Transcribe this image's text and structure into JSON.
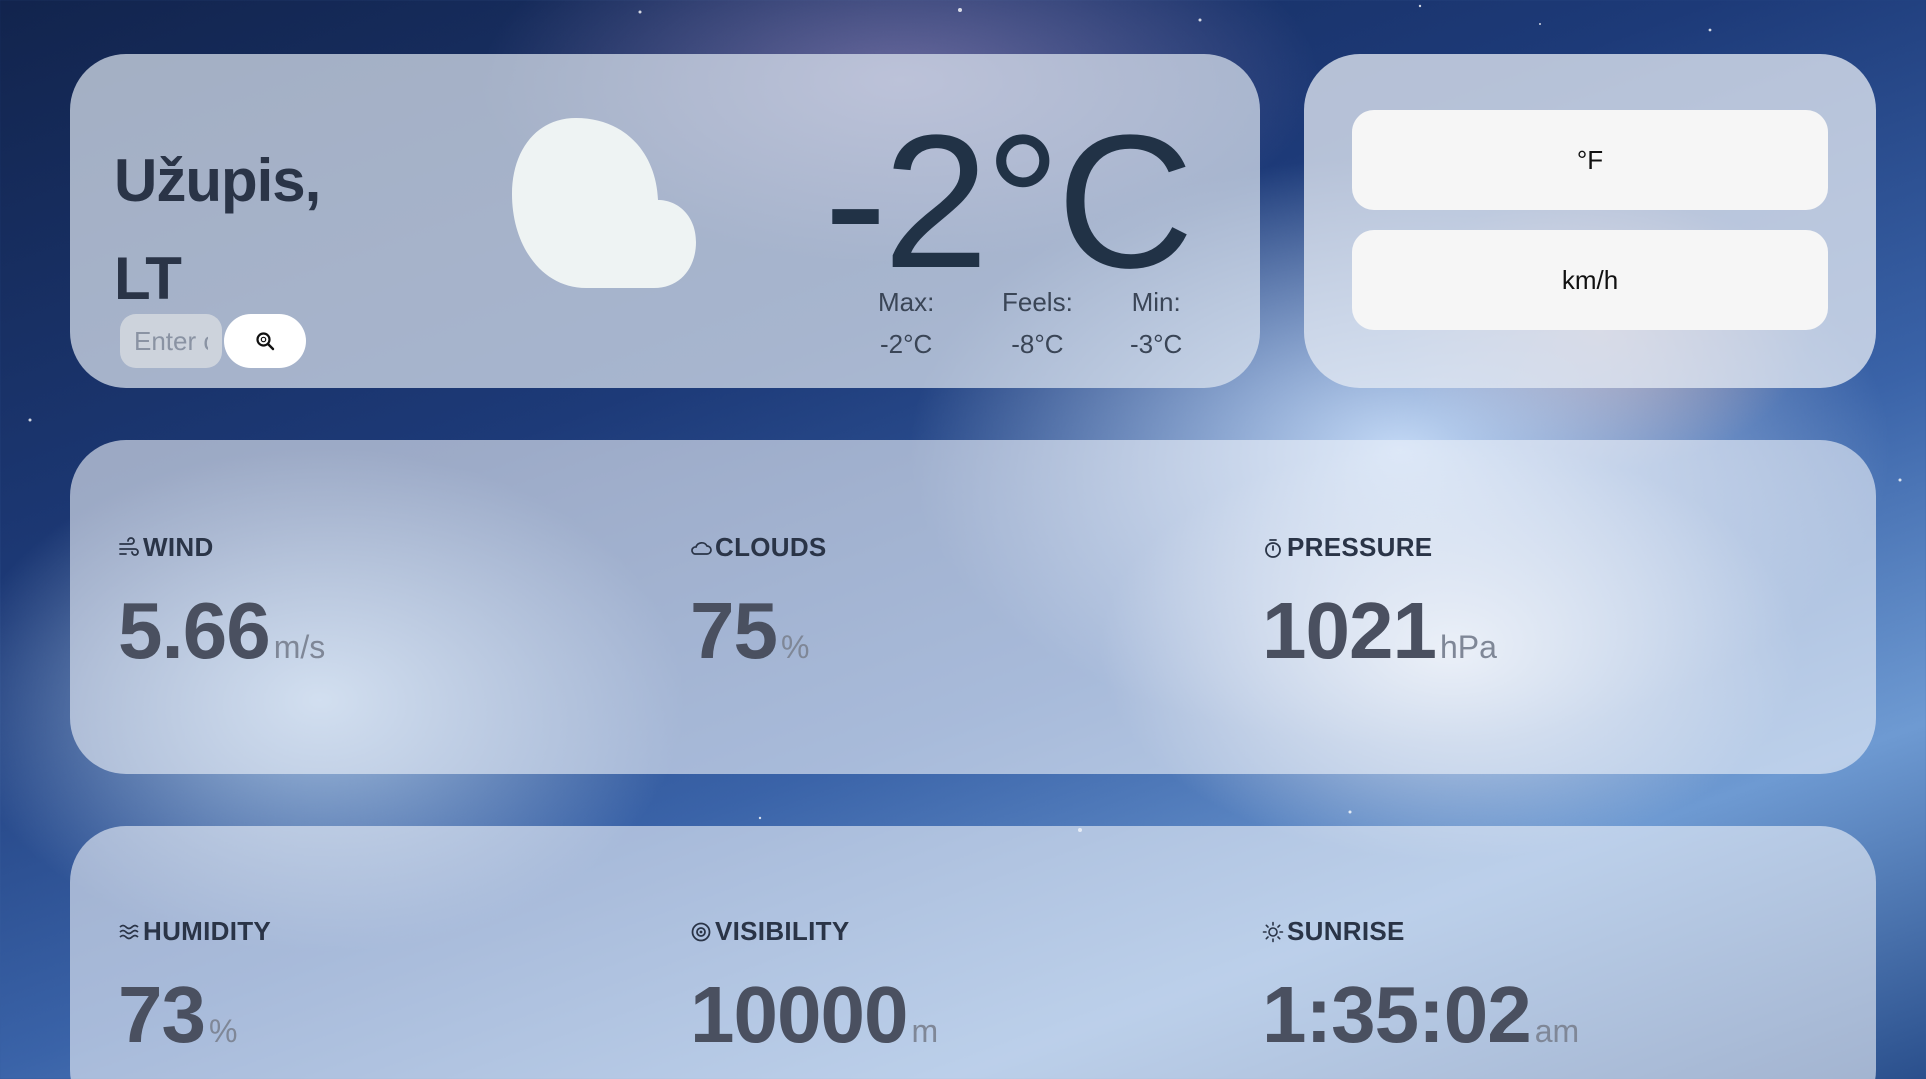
{
  "location": {
    "city": "Užupis,",
    "country": "LT"
  },
  "search": {
    "placeholder": "Enter c"
  },
  "current": {
    "condition_icon": "cloud-icon",
    "temperature": "-2°C",
    "max_label": "Max:",
    "max_value": "-2°C",
    "feels_label": "Feels:",
    "feels_value": "-8°C",
    "min_label": "Min:",
    "min_value": "-3°C"
  },
  "units": {
    "temp_toggle": "°F",
    "speed_toggle": "km/h"
  },
  "stats": {
    "wind": {
      "label": "WIND",
      "icon": "wind-icon",
      "value": "5.66",
      "unit": "m/s"
    },
    "clouds": {
      "label": "CLOUDS",
      "icon": "cloud-icon",
      "value": "75",
      "unit": "%"
    },
    "pressure": {
      "label": "PRESSURE",
      "icon": "gauge-icon",
      "value": "1021",
      "unit": "hPa"
    },
    "humidity": {
      "label": "HUMIDITY",
      "icon": "waves-icon",
      "value": "73",
      "unit": "%"
    },
    "visibility": {
      "label": "VISIBILITY",
      "icon": "eye-icon",
      "value": "10000",
      "unit": "m"
    },
    "sunrise": {
      "label": "SUNRISE",
      "icon": "sun-icon",
      "value": "1:35:02",
      "unit": "am"
    }
  },
  "colors": {
    "card_bg": "#dce4f0",
    "heading_text": "#2a3447",
    "temp_text": "#213246",
    "stat_value": "#4a5060",
    "button_bg": "#f6f6f6"
  }
}
